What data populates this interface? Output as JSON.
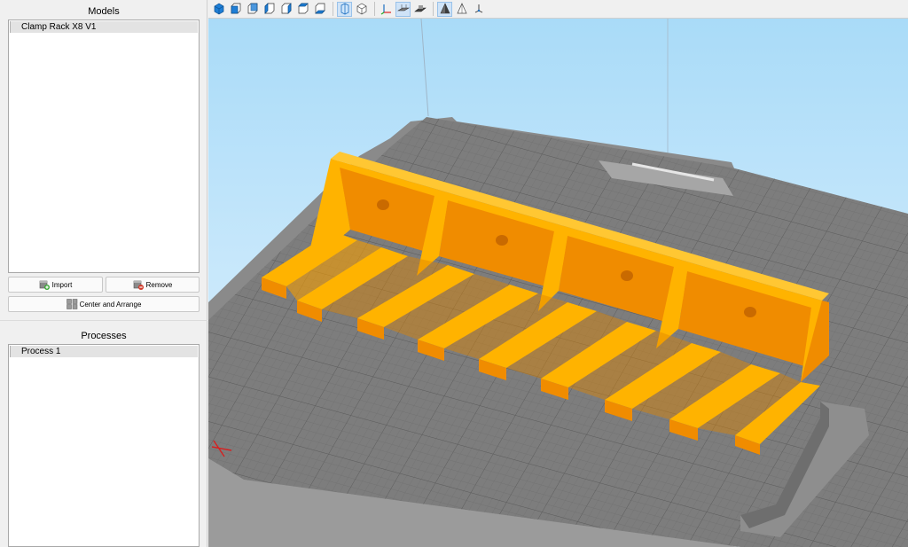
{
  "models": {
    "title": "Models",
    "items": [
      {
        "label": "Clamp Rack X8 V1"
      }
    ],
    "import_label": "Import",
    "remove_label": "Remove",
    "center_arrange_label": "Center and Arrange"
  },
  "processes": {
    "title": "Processes",
    "items": [
      {
        "label": "Process 1"
      }
    ]
  },
  "toolbar": {
    "buttons": [
      "view-iso-icon",
      "view-front-icon",
      "view-back-icon",
      "view-left-icon",
      "view-right-icon",
      "view-top-icon",
      "view-bottom-icon",
      "perspective-icon",
      "orthographic-icon",
      "axes-icon",
      "bed-icon",
      "shadow-icon",
      "solid-icon",
      "wireframe-icon",
      "origin-icon"
    ]
  },
  "colors": {
    "model_top": "#ffb300",
    "model_side": "#f08c00",
    "bed": "#7a7a7a",
    "sky_top": "#a9dbf8",
    "panel_bg": "#f0f0f0"
  }
}
